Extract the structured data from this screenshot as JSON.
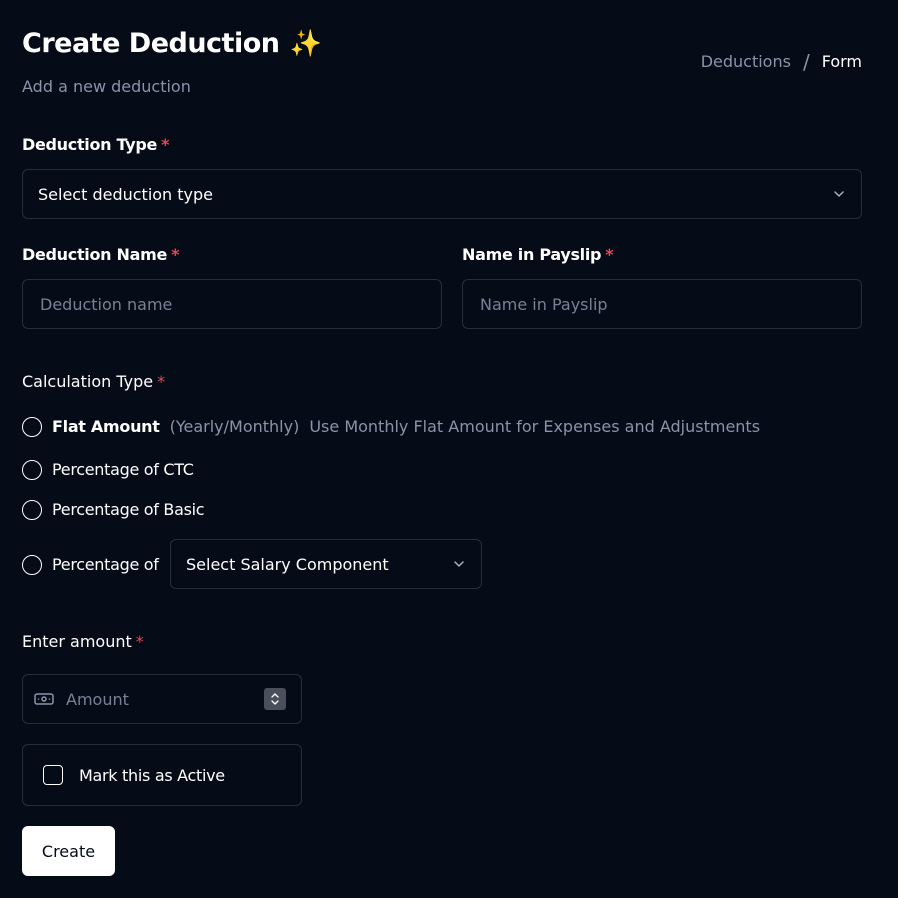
{
  "header": {
    "title": "Create Deduction",
    "title_emoji": "✨",
    "subtitle": "Add a new deduction",
    "breadcrumb": {
      "parent": "Deductions",
      "separator": "/",
      "current": "Form"
    }
  },
  "form": {
    "deduction_type": {
      "label": "Deduction Type",
      "required_mark": "*",
      "placeholder": "Select deduction type"
    },
    "deduction_name": {
      "label": "Deduction Name",
      "required_mark": "*",
      "placeholder": "Deduction name"
    },
    "payslip_name": {
      "label": "Name in Payslip",
      "required_mark": "*",
      "placeholder": "Name in Payslip"
    },
    "calculation_type": {
      "label": "Calculation Type",
      "required_mark": "*",
      "options": {
        "flat": {
          "label": "Flat Amount",
          "qualifier": "(Yearly/Monthly)",
          "hint": "Use Monthly Flat Amount for Expenses and Adjustments"
        },
        "ctc": {
          "label": "Percentage of CTC"
        },
        "basic": {
          "label": "Percentage of Basic"
        },
        "component": {
          "label": "Percentage of",
          "select_placeholder": "Select Salary Component"
        }
      }
    },
    "amount": {
      "label": "Enter amount",
      "required_mark": "*",
      "placeholder": "Amount",
      "icon": "money-icon"
    },
    "active": {
      "label": "Mark this as Active",
      "checked": false
    },
    "submit_label": "Create"
  }
}
